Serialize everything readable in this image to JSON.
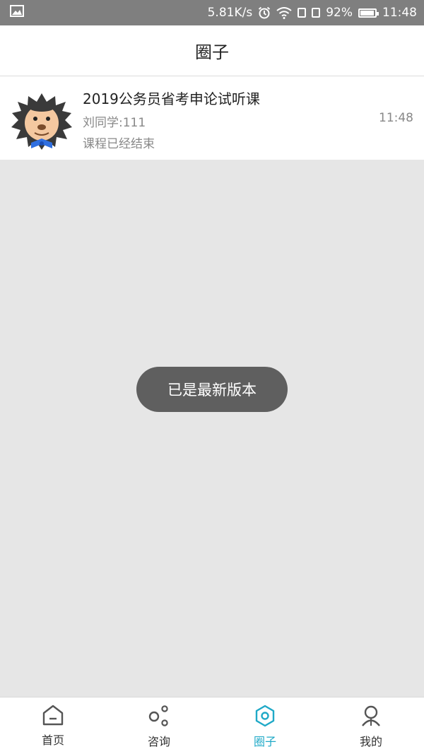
{
  "status_bar": {
    "network_speed": "5.81K/s",
    "battery": "92%",
    "time": "11:48",
    "icons": [
      "image-icon",
      "alarm-icon",
      "wifi-icon",
      "sim-icon",
      "battery-icon"
    ]
  },
  "header": {
    "title": "圈子"
  },
  "item": {
    "title": "2019公务员省考申论试听课",
    "sender": "刘同学:111",
    "status": "课程已经结束",
    "time": "11:48",
    "avatar": "lion-avatar"
  },
  "toast": {
    "text": "已是最新版本"
  },
  "tabs": [
    {
      "label": "首页",
      "icon": "home-icon"
    },
    {
      "label": "咨询",
      "icon": "consult-icon"
    },
    {
      "label": "圈子",
      "icon": "circle-hex-icon",
      "active": true
    },
    {
      "label": "我的",
      "icon": "person-icon"
    }
  ],
  "colors": {
    "accent": "#1fa9c7",
    "status_bar": "#7f7f7f",
    "toast": "#5f5f5f"
  }
}
